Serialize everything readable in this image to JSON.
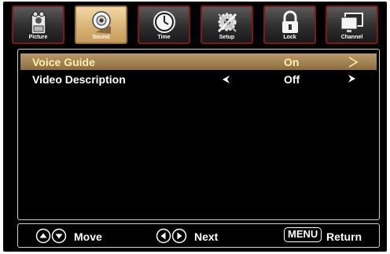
{
  "tabs": [
    {
      "label": "Picture",
      "icon": "picture-icon"
    },
    {
      "label": "Sound",
      "icon": "sound-icon",
      "active": true
    },
    {
      "label": "Time",
      "icon": "clock-icon"
    },
    {
      "label": "Setup",
      "icon": "setup-icon"
    },
    {
      "label": "Lock",
      "icon": "lock-icon"
    },
    {
      "label": "Channel",
      "icon": "channel-icon"
    }
  ],
  "menu": {
    "items": [
      {
        "label": "Voice Guide",
        "value": "On",
        "selected": true
      },
      {
        "label": "Video Description",
        "value": "Off",
        "selected": false
      }
    ]
  },
  "footer": {
    "move": "Move",
    "next": "Next",
    "menu_key": "MENU",
    "return": "Return"
  },
  "colors": {
    "active_tab": "#d8b073",
    "tab_border": "#7d1a18",
    "selected_row": "#a58557",
    "selected_text": "#fff2a8"
  }
}
